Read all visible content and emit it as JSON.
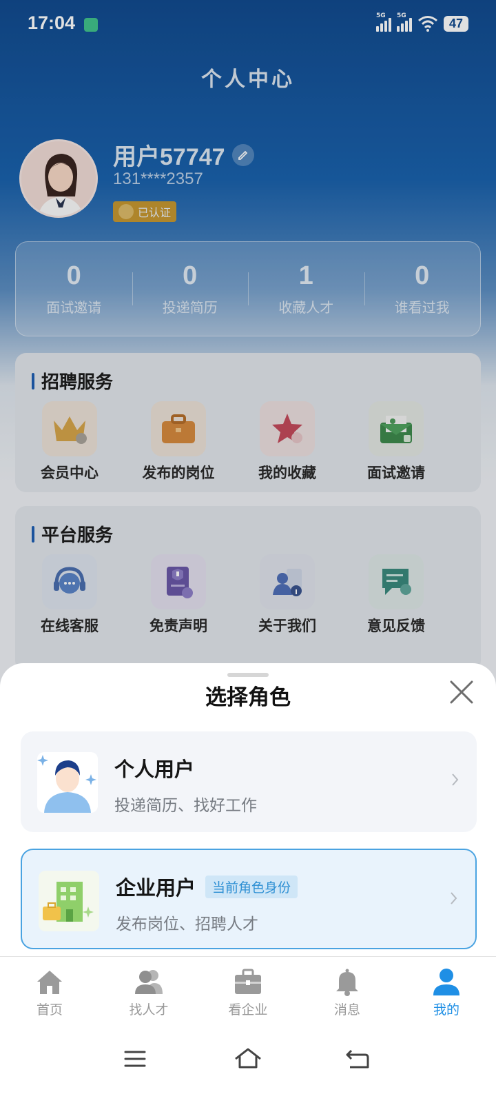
{
  "status_bar": {
    "time": "17:04",
    "network1": "5G",
    "network2": "5G",
    "battery": "47"
  },
  "page": {
    "title": "个人中心",
    "username": "用户57747",
    "phone": "131****2357",
    "verified": "已认证"
  },
  "stats": [
    {
      "value": "0",
      "label": "面试邀请"
    },
    {
      "value": "0",
      "label": "投递简历"
    },
    {
      "value": "1",
      "label": "收藏人才"
    },
    {
      "value": "0",
      "label": "谁看过我"
    }
  ],
  "recruit_section": {
    "title": "招聘服务",
    "items": [
      {
        "label": "会员中心",
        "icon": "crown-icon"
      },
      {
        "label": "发布的岗位",
        "icon": "briefcase-icon"
      },
      {
        "label": "我的收藏",
        "icon": "star-icon"
      },
      {
        "label": "面试邀请",
        "icon": "envelope-icon"
      }
    ]
  },
  "platform_section": {
    "title": "平台服务",
    "items": [
      {
        "label": "在线客服",
        "icon": "headset-icon"
      },
      {
        "label": "免责声明",
        "icon": "shield-document-icon"
      },
      {
        "label": "关于我们",
        "icon": "people-info-icon"
      },
      {
        "label": "意见反馈",
        "icon": "feedback-icon"
      }
    ]
  },
  "sheet": {
    "title": "选择角色",
    "roles": [
      {
        "name": "个人用户",
        "desc": "投递简历、找好工作",
        "current": false
      },
      {
        "name": "企业用户",
        "desc": "发布岗位、招聘人才",
        "current": true,
        "badge": "当前角色身份"
      }
    ]
  },
  "tabbar": [
    {
      "label": "首页",
      "icon": "home-icon",
      "active": false
    },
    {
      "label": "找人才",
      "icon": "people-icon",
      "active": false
    },
    {
      "label": "看企业",
      "icon": "briefcase-icon",
      "active": false
    },
    {
      "label": "消息",
      "icon": "bell-icon",
      "active": false
    },
    {
      "label": "我的",
      "icon": "user-icon",
      "active": true
    }
  ],
  "colors": {
    "accent": "#1f8fe5",
    "header_blue": "#124b8f",
    "selected_border": "#4aa3e1"
  }
}
